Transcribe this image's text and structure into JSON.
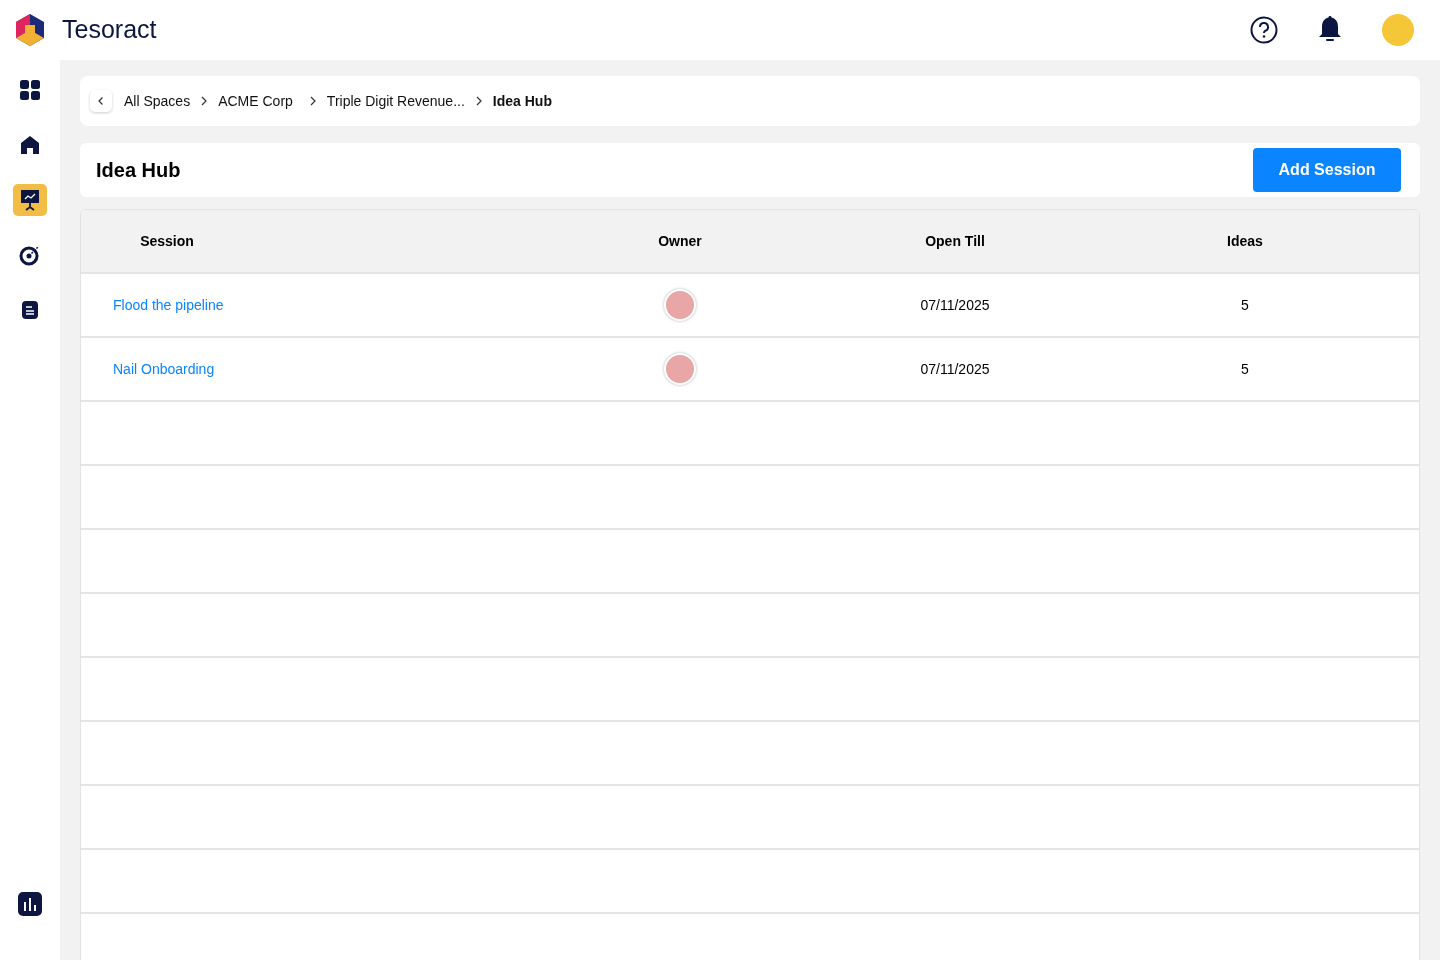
{
  "app": {
    "name": "Tesoract"
  },
  "sidebar": {
    "items": [
      {
        "selected": false
      },
      {
        "selected": false
      },
      {
        "selected": true
      },
      {
        "selected": false
      },
      {
        "selected": false
      }
    ],
    "bottom_items": [
      {
        "selected": false
      }
    ]
  },
  "breadcrumb": [
    {
      "label": "All Spaces",
      "current": false
    },
    {
      "label": "ACME Corp",
      "current": false
    },
    {
      "label": "Triple Digit Revenue...",
      "current": false
    },
    {
      "label": "Idea Hub",
      "current": true
    }
  ],
  "page": {
    "title": "Idea Hub",
    "action": "Add Session"
  },
  "table": {
    "columns": [
      "Session",
      "Owner",
      "Open Till",
      "Ideas"
    ],
    "rows": [
      {
        "session": "Flood the pipeline",
        "open_till": "07/11/2025",
        "ideas": "5"
      },
      {
        "session": "Nail Onboarding",
        "open_till": "07/11/2025",
        "ideas": "5"
      }
    ]
  }
}
